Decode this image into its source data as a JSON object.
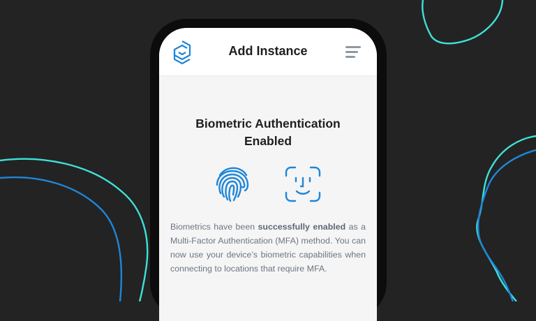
{
  "header": {
    "title": "Add Instance"
  },
  "content": {
    "heading": "Biometric Authentication Enabled",
    "description_prefix": "Biometrics have been ",
    "description_bold": "successfully enabled",
    "description_suffix": " as a Multi-Factor Authentication (MFA) method. You can now use your device’s biometric capabilities when connecting to locations that require MFA."
  },
  "icons": {
    "logo": "brand-logo-icon",
    "menu": "hamburger-menu-icon",
    "fingerprint": "fingerprint-icon",
    "face": "face-id-icon"
  },
  "colors": {
    "background": "#232323",
    "accent_blue": "#1e86d8",
    "accent_teal": "#3fe0d8",
    "text_dark": "#1f1f1f",
    "text_muted": "#6c7682"
  }
}
